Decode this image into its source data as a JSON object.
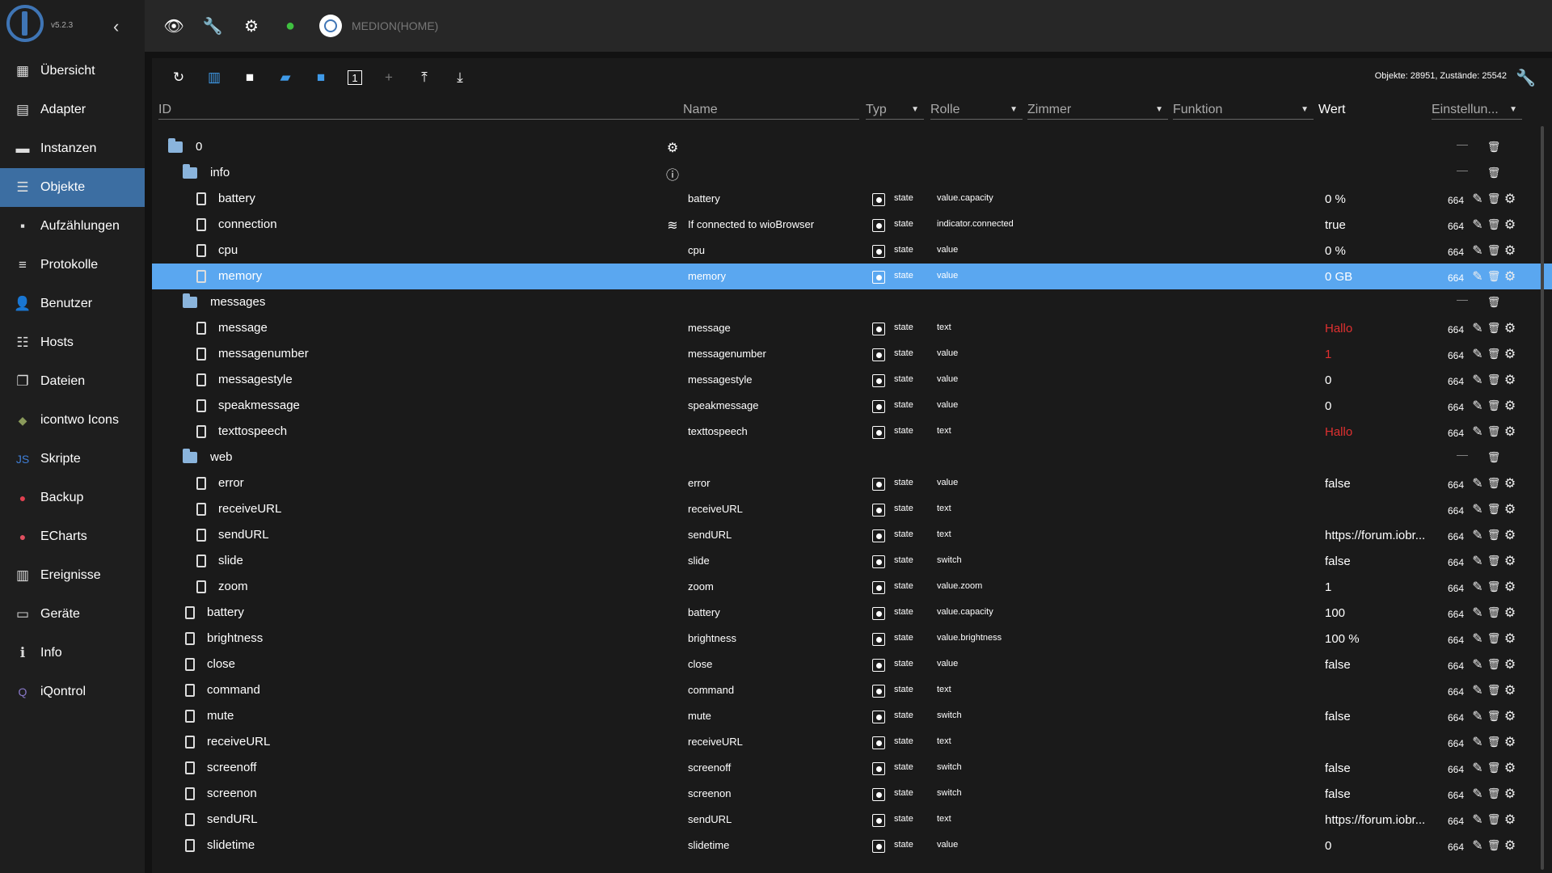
{
  "app": {
    "version": "v5.2.3"
  },
  "sidebar": {
    "items": [
      {
        "label": "Übersicht",
        "icon": "grid-icon",
        "glyph": "▦",
        "active": false
      },
      {
        "label": "Adapter",
        "icon": "store-icon",
        "glyph": "▤",
        "active": false
      },
      {
        "label": "Instanzen",
        "icon": "instances-icon",
        "glyph": "▬",
        "active": false
      },
      {
        "label": "Objekte",
        "icon": "list-icon",
        "glyph": "☰",
        "active": true
      },
      {
        "label": "Aufzählungen",
        "icon": "enum-icon",
        "glyph": "▪",
        "active": false
      },
      {
        "label": "Protokolle",
        "icon": "log-icon",
        "glyph": "≡",
        "active": false
      },
      {
        "label": "Benutzer",
        "icon": "user-icon",
        "glyph": "👤",
        "active": false
      },
      {
        "label": "Hosts",
        "icon": "hosts-icon",
        "glyph": "☷",
        "active": false
      },
      {
        "label": "Dateien",
        "icon": "files-icon",
        "glyph": "❐",
        "active": false
      },
      {
        "label": "icontwo Icons",
        "icon": "icontwo-icon",
        "glyph": "◆",
        "color": "#8a9a5b",
        "active": false
      },
      {
        "label": "Skripte",
        "icon": "scripts-icon",
        "glyph": "JS",
        "color": "#3f7fd8",
        "active": false
      },
      {
        "label": "Backup",
        "icon": "backup-icon",
        "glyph": "●",
        "color": "#e04050",
        "active": false
      },
      {
        "label": "ECharts",
        "icon": "echarts-icon",
        "glyph": "●",
        "color": "#e05060",
        "active": false
      },
      {
        "label": "Ereignisse",
        "icon": "events-icon",
        "glyph": "▥",
        "active": false
      },
      {
        "label": "Geräte",
        "icon": "devices-icon",
        "glyph": "▭",
        "active": false
      },
      {
        "label": "Info",
        "icon": "info-icon",
        "glyph": "ℹ",
        "active": false
      },
      {
        "label": "iQontrol",
        "icon": "iqontrol-icon",
        "glyph": "Q",
        "color": "#8878c8",
        "active": false
      }
    ]
  },
  "topbar": {
    "host": "MEDION(HOME)"
  },
  "toolbar": {
    "counts": "Objekte: 28951, Zustände: 25542"
  },
  "columns": {
    "id": "ID",
    "name": "Name",
    "typ": "Typ",
    "rolle": "Rolle",
    "zimmer": "Zimmer",
    "funktion": "Funktion",
    "wert": "Wert",
    "einstellungen": "Einstellun..."
  },
  "rows": [
    {
      "id": "0",
      "kind": "folder",
      "level": 0,
      "name": "",
      "name_icon": "gear-badge-icon",
      "typ": "",
      "rolle": "",
      "wert": "",
      "num": ""
    },
    {
      "id": "info",
      "kind": "folder",
      "level": 1,
      "name": "",
      "name_icon": "info-circle-icon",
      "typ": "",
      "rolle": "",
      "wert": "",
      "num": ""
    },
    {
      "id": "battery",
      "kind": "file",
      "level": 2,
      "name": "battery",
      "typ": "state",
      "rolle": "value.capacity",
      "wert": "0 %",
      "num": "664"
    },
    {
      "id": "connection",
      "kind": "file",
      "level": 2,
      "name": "If connected to wioBrowser",
      "name_icon": "wifi-icon",
      "typ": "state",
      "rolle": "indicator.connected",
      "wert": "true",
      "num": "664"
    },
    {
      "id": "cpu",
      "kind": "file",
      "level": 2,
      "name": "cpu",
      "typ": "state",
      "rolle": "value",
      "wert": "0 %",
      "num": "664"
    },
    {
      "id": "memory",
      "kind": "file",
      "level": 2,
      "name": "memory",
      "typ": "state",
      "rolle": "value",
      "wert": "0 GB",
      "num": "664",
      "selected": true
    },
    {
      "id": "messages",
      "kind": "folder",
      "level": 1,
      "name": "",
      "typ": "",
      "rolle": "",
      "wert": "",
      "num": ""
    },
    {
      "id": "message",
      "kind": "file",
      "level": 2,
      "name": "message",
      "typ": "state",
      "rolle": "text",
      "wert": "Hallo",
      "red": true,
      "num": "664"
    },
    {
      "id": "messagenumber",
      "kind": "file",
      "level": 2,
      "name": "messagenumber",
      "typ": "state",
      "rolle": "value",
      "wert": "1",
      "red": true,
      "num": "664"
    },
    {
      "id": "messagestyle",
      "kind": "file",
      "level": 2,
      "name": "messagestyle",
      "typ": "state",
      "rolle": "value",
      "wert": "0",
      "num": "664"
    },
    {
      "id": "speakmessage",
      "kind": "file",
      "level": 2,
      "name": "speakmessage",
      "typ": "state",
      "rolle": "value",
      "wert": "0",
      "num": "664"
    },
    {
      "id": "texttospeech",
      "kind": "file",
      "level": 2,
      "name": "texttospeech",
      "typ": "state",
      "rolle": "text",
      "wert": "Hallo",
      "red": true,
      "num": "664"
    },
    {
      "id": "web",
      "kind": "folder",
      "level": 1,
      "name": "",
      "typ": "",
      "rolle": "",
      "wert": "",
      "num": ""
    },
    {
      "id": "error",
      "kind": "file",
      "level": 2,
      "name": "error",
      "typ": "state",
      "rolle": "value",
      "wert": "false",
      "num": "664"
    },
    {
      "id": "receiveURL",
      "kind": "file",
      "level": 2,
      "name": "receiveURL",
      "typ": "state",
      "rolle": "text",
      "wert": "",
      "num": "664"
    },
    {
      "id": "sendURL",
      "kind": "file",
      "level": 2,
      "name": "sendURL",
      "typ": "state",
      "rolle": "text",
      "wert": "https://forum.iobr...",
      "num": "664"
    },
    {
      "id": "slide",
      "kind": "file",
      "level": 2,
      "name": "slide",
      "typ": "state",
      "rolle": "switch",
      "wert": "false",
      "num": "664"
    },
    {
      "id": "zoom",
      "kind": "file",
      "level": 2,
      "name": "zoom",
      "typ": "state",
      "rolle": "value.zoom",
      "wert": "1",
      "num": "664"
    },
    {
      "id": "battery",
      "kind": "file",
      "level": 1,
      "name": "battery",
      "typ": "state",
      "rolle": "value.capacity",
      "wert": "100",
      "num": "664"
    },
    {
      "id": "brightness",
      "kind": "file",
      "level": 1,
      "name": "brightness",
      "typ": "state",
      "rolle": "value.brightness",
      "wert": "100 %",
      "num": "664"
    },
    {
      "id": "close",
      "kind": "file",
      "level": 1,
      "name": "close",
      "typ": "state",
      "rolle": "value",
      "wert": "false",
      "num": "664"
    },
    {
      "id": "command",
      "kind": "file",
      "level": 1,
      "name": "command",
      "typ": "state",
      "rolle": "text",
      "wert": "",
      "num": "664"
    },
    {
      "id": "mute",
      "kind": "file",
      "level": 1,
      "name": "mute",
      "typ": "state",
      "rolle": "switch",
      "wert": "false",
      "num": "664"
    },
    {
      "id": "receiveURL",
      "kind": "file",
      "level": 1,
      "name": "receiveURL",
      "typ": "state",
      "rolle": "text",
      "wert": "",
      "num": "664"
    },
    {
      "id": "screenoff",
      "kind": "file",
      "level": 1,
      "name": "screenoff",
      "typ": "state",
      "rolle": "switch",
      "wert": "false",
      "num": "664"
    },
    {
      "id": "screenon",
      "kind": "file",
      "level": 1,
      "name": "screenon",
      "typ": "state",
      "rolle": "switch",
      "wert": "false",
      "num": "664"
    },
    {
      "id": "sendURL",
      "kind": "file",
      "level": 1,
      "name": "sendURL",
      "typ": "state",
      "rolle": "text",
      "wert": "https://forum.iobr...",
      "num": "664"
    },
    {
      "id": "slidetime",
      "kind": "file",
      "level": 1,
      "name": "slidetime",
      "typ": "state",
      "rolle": "value",
      "wert": "0",
      "num": "664"
    }
  ]
}
